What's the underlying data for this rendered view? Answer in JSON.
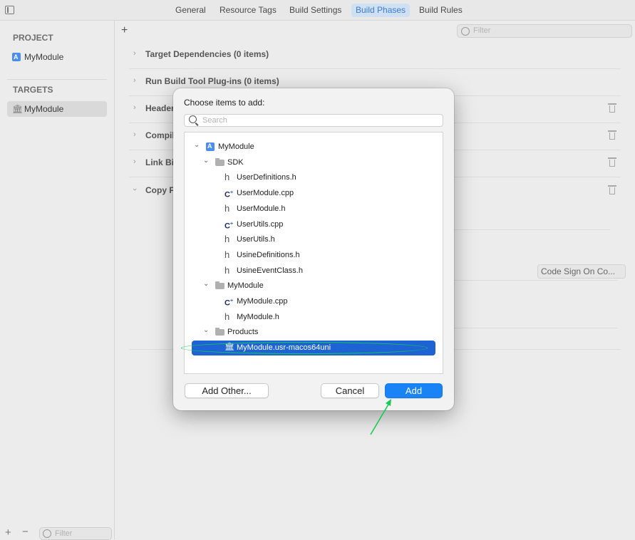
{
  "tabs": [
    "General",
    "Resource Tags",
    "Build Settings",
    "Build Phases",
    "Build Rules"
  ],
  "active_tab": "Build Phases",
  "sidebar": {
    "project_label": "PROJECT",
    "project_item": "MyModule",
    "targets_label": "TARGETS",
    "target_item": "MyModule",
    "filter_placeholder": "Filter"
  },
  "main": {
    "filter_placeholder": "Filter",
    "phases": [
      {
        "title": "Target Dependencies (0 items)"
      },
      {
        "title": "Run Build Tool Plug-ins (0 items)"
      },
      {
        "title": "Header"
      },
      {
        "title": "Compil"
      },
      {
        "title": "Link Bi"
      },
      {
        "title": "Copy Fi"
      }
    ],
    "code_sign_label": "Code Sign On Co..."
  },
  "dialog": {
    "title": "Choose items to add:",
    "search_placeholder": "Search",
    "tree": [
      {
        "label": "MyModule",
        "icon": "app-icon",
        "level": 0,
        "expanded": true
      },
      {
        "label": "SDK",
        "icon": "folder-icon",
        "level": 1,
        "expanded": true
      },
      {
        "label": "UserDefinitions.h",
        "icon": "header-file-icon",
        "level": 2
      },
      {
        "label": "UserModule.cpp",
        "icon": "cpp-file-icon",
        "level": 2
      },
      {
        "label": "UserModule.h",
        "icon": "header-file-icon",
        "level": 2
      },
      {
        "label": "UserUtils.cpp",
        "icon": "cpp-file-icon",
        "level": 2
      },
      {
        "label": "UserUtils.h",
        "icon": "header-file-icon",
        "level": 2
      },
      {
        "label": "UsineDefinitions.h",
        "icon": "header-file-icon",
        "level": 2
      },
      {
        "label": "UsineEventClass.h",
        "icon": "header-file-icon",
        "level": 2
      },
      {
        "label": "MyModule",
        "icon": "folder-icon",
        "level": 1,
        "expanded": true
      },
      {
        "label": "MyModule.cpp",
        "icon": "cpp-file-icon",
        "level": 2
      },
      {
        "label": "MyModule.h",
        "icon": "header-file-icon",
        "level": 2
      },
      {
        "label": "Products",
        "icon": "folder-icon",
        "level": 1,
        "expanded": true
      },
      {
        "label": "MyModule.usr-macos64uni",
        "icon": "bundle-icon",
        "level": 2,
        "selected": true
      }
    ],
    "add_other_label": "Add Other...",
    "cancel_label": "Cancel",
    "add_label": "Add"
  },
  "colors": {
    "accent": "#1a84f7",
    "selection": "#1e63d3",
    "annotation": "#17c956"
  }
}
